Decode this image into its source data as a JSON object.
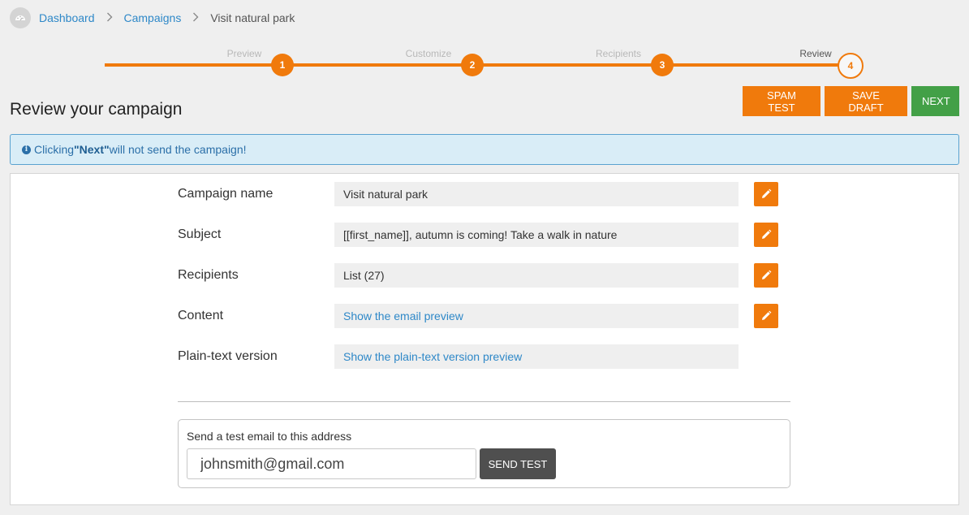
{
  "breadcrumb": {
    "items": [
      {
        "label": "Dashboard"
      },
      {
        "label": "Campaigns"
      }
    ],
    "current": "Visit natural park",
    "separator": ">"
  },
  "stepper": {
    "steps": [
      {
        "label": "Preview",
        "number": "1",
        "state": "done"
      },
      {
        "label": "Customize",
        "number": "2",
        "state": "done"
      },
      {
        "label": "Recipients",
        "number": "3",
        "state": "done"
      },
      {
        "label": "Review",
        "number": "4",
        "state": "current"
      }
    ]
  },
  "page": {
    "title": "Review your campaign"
  },
  "actions": {
    "spam_test": "SPAM TEST",
    "save_draft": "SAVE DRAFT",
    "next": "NEXT"
  },
  "alert": {
    "prefix": "Clicking ",
    "highlight": "\"Next\"",
    "suffix": " will not send the campaign!"
  },
  "review": {
    "rows": [
      {
        "label": "Campaign name",
        "value": "Visit natural park"
      },
      {
        "label": "Subject",
        "value": "[[first_name]], autumn is coming! Take a walk in nature"
      },
      {
        "label": "Recipients",
        "value": "List (27)"
      },
      {
        "label": "Content",
        "value": "Show the email preview"
      },
      {
        "label": "Plain-text version",
        "value": "Show the plain-text version preview"
      }
    ]
  },
  "test_email": {
    "label": "Send a test email to this address",
    "value": "johnsmith@gmail.com",
    "button": "SEND TEST"
  },
  "colors": {
    "accent": "#f07a0c",
    "success": "#43a047",
    "link": "#2e88c8",
    "info_bg": "#d9edf7"
  }
}
